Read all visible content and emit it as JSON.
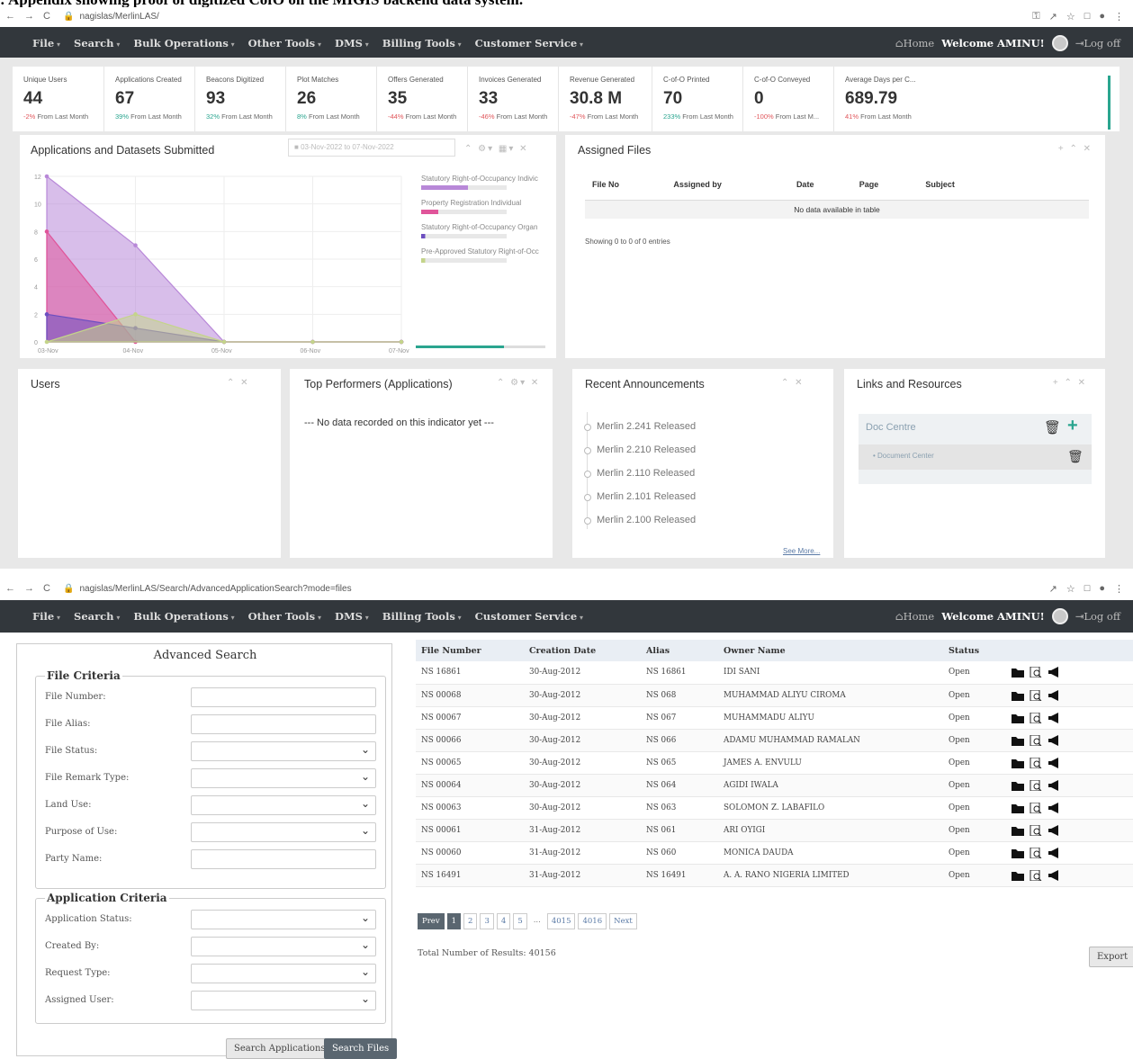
{
  "doc_caption": ": Appendix showing proof of digitized CofO on the MIGIS backend data system.",
  "screen1": {
    "url": "nagislas/MerlinLAS/",
    "menu": [
      "File",
      "Search",
      "Bulk Operations",
      "Other Tools",
      "DMS",
      "Billing Tools",
      "Customer Service"
    ],
    "home": "⌂Home",
    "welcome": "Welcome AMINU!",
    "logoff": "⇥Log off",
    "stats": [
      {
        "label": "Unique Users",
        "value": "44",
        "change": "-2%",
        "suffix": "From Last Month",
        "dir": "down"
      },
      {
        "label": "Applications Created",
        "value": "67",
        "change": "39%",
        "suffix": "From Last Month",
        "dir": "up"
      },
      {
        "label": "Beacons Digitized",
        "value": "93",
        "change": "32%",
        "suffix": "From Last Month",
        "dir": "up"
      },
      {
        "label": "Plot Matches",
        "value": "26",
        "change": "8%",
        "suffix": "From Last Month",
        "dir": "up"
      },
      {
        "label": "Offers Generated",
        "value": "35",
        "change": "-44%",
        "suffix": "From Last Month",
        "dir": "down"
      },
      {
        "label": "Invoices Generated",
        "value": "33",
        "change": "-46%",
        "suffix": "From Last Month",
        "dir": "down"
      },
      {
        "label": "Revenue Generated",
        "value": "30.8 M",
        "change": "-47%",
        "suffix": "From Last Month",
        "dir": "down"
      },
      {
        "label": "C-of-O Printed",
        "value": "70",
        "change": "233%",
        "suffix": "From Last Month",
        "dir": "up"
      },
      {
        "label": "C-of-O Conveyed",
        "value": "0",
        "change": "-100%",
        "suffix": "From Last M...",
        "dir": "down"
      },
      {
        "label": "Average Days per C...",
        "value": "689.79",
        "change": "41%",
        "suffix": "From Last Month",
        "dir": "down"
      }
    ],
    "chart_panel": {
      "title": "Applications and Datasets Submitted",
      "date_range": "03-Nov-2022 to 07-Nov-2022"
    },
    "assigned": {
      "title": "Assigned Files",
      "columns": [
        "File No",
        "Assigned by",
        "Date",
        "Page",
        "Subject",
        "",
        "",
        ""
      ],
      "empty": "No data available in table",
      "info": "Showing 0 to 0 of 0 entries"
    },
    "users": {
      "title": "Users"
    },
    "top": {
      "title": "Top Performers (Applications)",
      "empty": "--- No data recorded on this indicator yet ---"
    },
    "announcements": {
      "title": "Recent Announcements",
      "items": [
        "Merlin 2.241 Released",
        "Merlin 2.210 Released",
        "Merlin 2.110 Released",
        "Merlin 2.101 Released",
        "Merlin 2.100 Released"
      ],
      "see_more": "See More..."
    },
    "links": {
      "title": "Links and Resources",
      "doc_centre": "Doc Centre",
      "doc_center": "Document Center"
    }
  },
  "chart_data": {
    "type": "area",
    "x": [
      "03-Nov",
      "04-Nov",
      "05-Nov",
      "06-Nov",
      "07-Nov"
    ],
    "ylim": [
      0,
      12
    ],
    "yticks": [
      0,
      2,
      4,
      6,
      8,
      10,
      12
    ],
    "series": [
      {
        "name": "Statutory Right-of-Occupancy Indivic",
        "color": "#b888d8",
        "values": [
          12,
          7,
          0,
          0,
          0
        ]
      },
      {
        "name": "Property Registration Individual",
        "color": "#e0559a",
        "values": [
          8,
          0,
          0,
          0,
          0
        ]
      },
      {
        "name": "Statutory Right-of-Occupancy Organ",
        "color": "#6d4fc0",
        "values": [
          2,
          1,
          0,
          0,
          0
        ]
      },
      {
        "name": "Pre-Approved Statutory Right-of-Occ",
        "color": "#c4d48a",
        "values": [
          0,
          2,
          0,
          0,
          0
        ]
      }
    ],
    "legend": "right"
  },
  "screen2": {
    "url": "nagislas/MerlinLAS/Search/AdvancedApplicationSearch?mode=files",
    "search": {
      "title": "Advanced Search",
      "file_criteria": "File Criteria",
      "file_fields": [
        {
          "label": "File Number:",
          "kind": "input"
        },
        {
          "label": "File Alias:",
          "kind": "input"
        },
        {
          "label": "File Status:",
          "kind": "select"
        },
        {
          "label": "File Remark Type:",
          "kind": "select"
        },
        {
          "label": "Land Use:",
          "kind": "select"
        },
        {
          "label": "Purpose of Use:",
          "kind": "select"
        },
        {
          "label": "Party Name:",
          "kind": "input"
        }
      ],
      "app_criteria": "Application Criteria",
      "app_fields": [
        {
          "label": "Application Status:",
          "kind": "select"
        },
        {
          "label": "Created By:",
          "kind": "select"
        },
        {
          "label": "Request Type:",
          "kind": "select"
        },
        {
          "label": "Assigned User:",
          "kind": "select"
        }
      ],
      "btn_apps": "Search Applications",
      "btn_files": "Search Files"
    },
    "results": {
      "columns": [
        "File Number",
        "Creation Date",
        "Alias",
        "Owner Name",
        "Status",
        ""
      ],
      "rows": [
        [
          "NS 16861",
          "30-Aug-2012",
          "NS 16861",
          "IDI SANI",
          "Open"
        ],
        [
          "NS 00068",
          "30-Aug-2012",
          "NS 068",
          "MUHAMMAD ALIYU CIROMA",
          "Open"
        ],
        [
          "NS 00067",
          "30-Aug-2012",
          "NS 067",
          "MUHAMMADU ALIYU",
          "Open"
        ],
        [
          "NS 00066",
          "30-Aug-2012",
          "NS 066",
          "ADAMU MUHAMMAD RAMALAN",
          "Open"
        ],
        [
          "NS 00065",
          "30-Aug-2012",
          "NS 065",
          "JAMES A. ENVULU",
          "Open"
        ],
        [
          "NS 00064",
          "30-Aug-2012",
          "NS 064",
          "AGIDI IWALA",
          "Open"
        ],
        [
          "NS 00063",
          "30-Aug-2012",
          "NS 063",
          "SOLOMON Z. LABAFILO",
          "Open"
        ],
        [
          "NS 00061",
          "31-Aug-2012",
          "NS 061",
          "ARI OYIGI",
          "Open"
        ],
        [
          "NS 00060",
          "31-Aug-2012",
          "NS 060",
          "MONICA DAUDA",
          "Open"
        ],
        [
          "NS 16491",
          "31-Aug-2012",
          "NS 16491",
          "A. A. RANO NIGERIA LIMITED",
          "Open"
        ]
      ],
      "pager": [
        "Prev",
        "1",
        "2",
        "3",
        "4",
        "5",
        "...",
        "4015",
        "4016",
        "Next"
      ],
      "total": "Total Number of Results: 40156",
      "export": "Export"
    }
  }
}
